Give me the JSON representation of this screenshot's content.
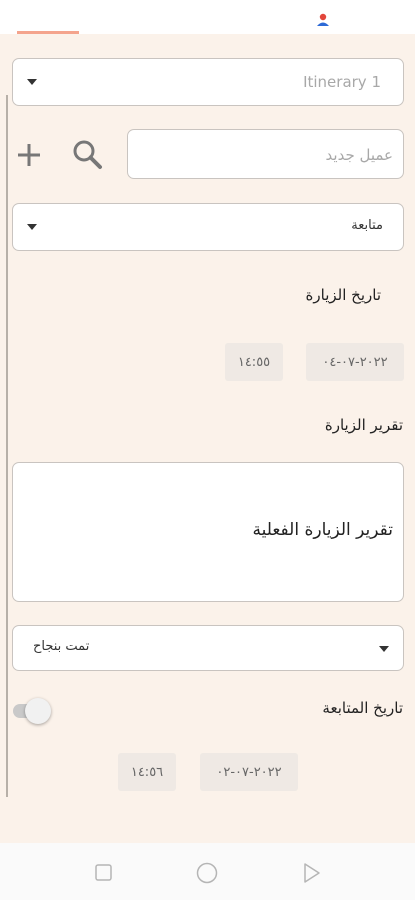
{
  "itinerary": {
    "selected": "Itinerary 1"
  },
  "client": {
    "placeholder": "عميل جديد"
  },
  "visit_type": {
    "selected": "متابعة"
  },
  "visit_date": {
    "label": "تاريخ الزيارة",
    "date": "٢٠٢٢-٠٧-٠٤",
    "time": "١٤:٥٥"
  },
  "visit_report": {
    "label": "تقرير الزيارة",
    "text": "تقرير الزيارة الفعلية"
  },
  "status": {
    "selected": "تمت بنجاح"
  },
  "followup": {
    "label": "تاريخ المتابعة",
    "date": "٢٠٢٢-٠٧-٠٢",
    "time": "١٤:٥٦",
    "toggle_on": false
  },
  "colors": {
    "background": "#fbf2ea",
    "tab_indicator": "#f4a48d",
    "avatar_red": "#e2463b",
    "avatar_blue": "#2d6ad6"
  },
  "icons": [
    "person-icon",
    "plus-icon",
    "search-icon",
    "dropdown-arrow-icon",
    "nav-square-icon",
    "nav-circle-icon",
    "nav-triangle-icon"
  ]
}
